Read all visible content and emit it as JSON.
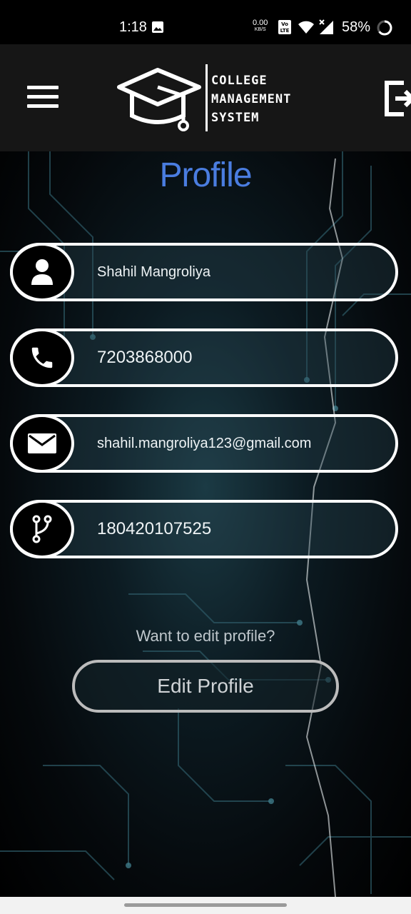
{
  "status_bar": {
    "time": "1:18",
    "net_speed": "0.00",
    "net_unit": "KB/S",
    "battery": "58%",
    "icons": [
      "image-icon",
      "volte-icon",
      "wifi-icon",
      "signal-icon",
      "battery-icon"
    ]
  },
  "app_bar": {
    "logo_lines": [
      "COLLEGE",
      "MANAGEMENT",
      "SYSTEM"
    ],
    "menu_icon": "hamburger-menu-icon",
    "logout_icon": "logout-icon"
  },
  "page": {
    "title": "Profile",
    "title_color": "#4a7de0"
  },
  "profile_fields": [
    {
      "icon": "person-icon",
      "value": "Shahil Mangroliya"
    },
    {
      "icon": "phone-icon",
      "value": "7203868000"
    },
    {
      "icon": "email-icon",
      "value": "shahil.mangroliya123@gmail.com"
    },
    {
      "icon": "branch-icon",
      "value": "180420107525"
    }
  ],
  "edit": {
    "prompt": "Want to edit profile?",
    "button_label": "Edit Profile"
  }
}
